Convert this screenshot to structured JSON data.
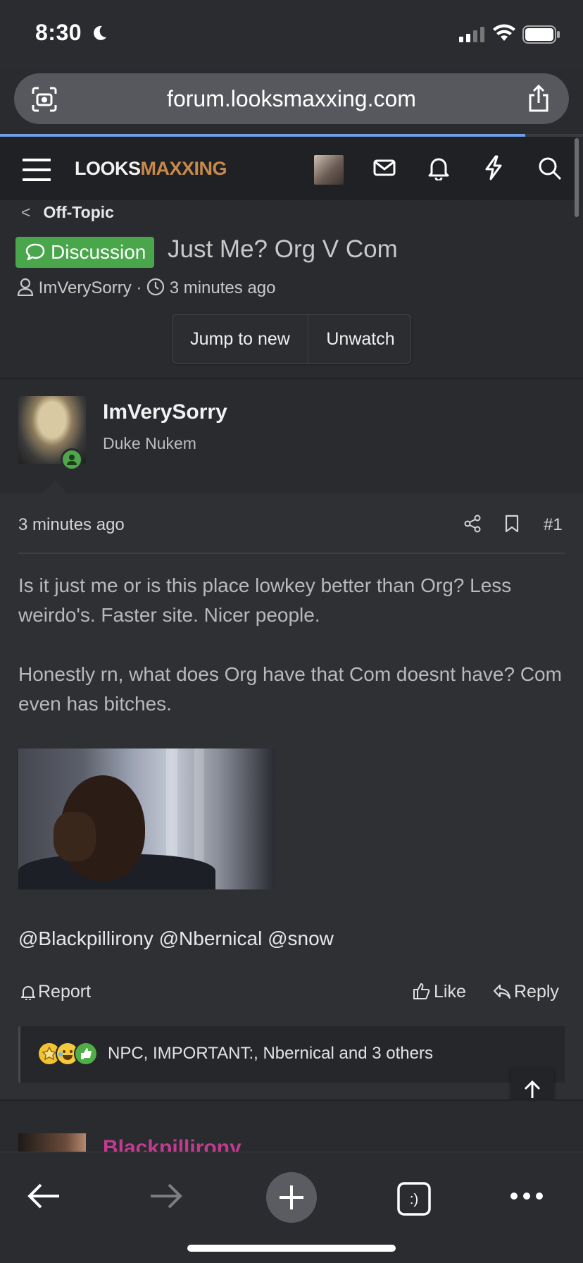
{
  "status_bar": {
    "time": "8:30"
  },
  "browser": {
    "url": "forum.looksmaxxing.com"
  },
  "site": {
    "logo_part1": "LOOKS",
    "logo_part2": "MAXXING",
    "accent_color": "#c8894a"
  },
  "breadcrumb": {
    "label": "Off-Topic"
  },
  "thread": {
    "prefix": "Discussion",
    "title": "Just Me? Org V Com",
    "author": "ImVerySorry",
    "separator": "·",
    "time": "3 minutes ago"
  },
  "buttons": {
    "jump_to_new": "Jump to new",
    "unwatch": "Unwatch"
  },
  "post": {
    "username": "ImVerySorry",
    "user_title": "Duke Nukem",
    "time": "3 minutes ago",
    "number": "#1",
    "paragraph1": "Is it just me or is this place lowkey better than Org? Less weirdo's. Faster site. Nicer people.",
    "paragraph2": "Honestly rn, what does Org have that Com doesnt have? Com even has bitches.",
    "mentions": "@Blackpillirony @Nbernical @snow",
    "actions": {
      "report": "Report",
      "like": "Like",
      "reply": "Reply"
    },
    "reactions_text": "NPC, IMPORTANT:, Nbernical and 3 others"
  },
  "next_post": {
    "username": "Blackpillirony"
  },
  "icons": [
    "moon-icon",
    "signal-icon",
    "wifi-icon",
    "battery-icon",
    "camera-icon",
    "share-icon",
    "menu-icon",
    "mail-icon",
    "bell-icon",
    "bolt-icon",
    "search-icon",
    "chat-icon",
    "user-icon",
    "clock-icon",
    "post-share-icon",
    "bookmark-icon",
    "report-icon",
    "like-icon",
    "reply-icon",
    "arrow-up-icon",
    "back-icon",
    "forward-icon",
    "plus-icon",
    "tabs-icon",
    "more-icon"
  ],
  "colors": {
    "prefix_green": "#4aa64a",
    "next_user_color": "#c23b8f"
  }
}
